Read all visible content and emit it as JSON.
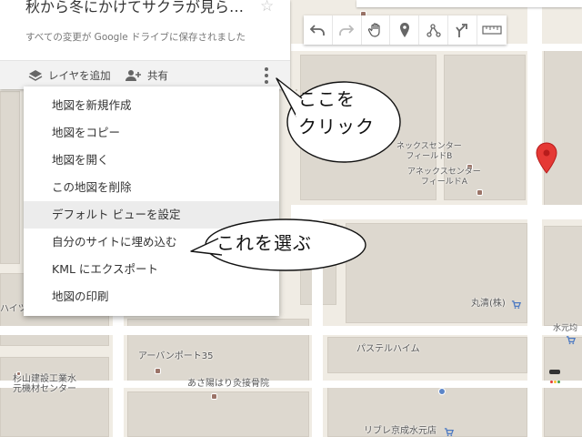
{
  "panel": {
    "title": "秋から冬にかけてサクラが見られ…",
    "star_icon": "star-outline-icon",
    "save_status": "すべての変更が Google ドライブに保存されました",
    "add_layer_label": "レイヤを追加",
    "share_label": "共有"
  },
  "menu": {
    "items": [
      {
        "label": "地図を新規作成"
      },
      {
        "label": "地図をコピー"
      },
      {
        "label": "地図を開く"
      },
      {
        "label": "この地図を削除"
      },
      {
        "label": "デフォルト ビューを設定"
      },
      {
        "label": "自分のサイトに埋め込む"
      },
      {
        "label": "KML にエクスポート"
      },
      {
        "label": "地図の印刷"
      }
    ],
    "highlighted_index": 4
  },
  "map_toolbar": {
    "buttons": [
      "undo-icon",
      "redo-icon",
      "hand-pan-icon",
      "add-marker-icon",
      "draw-line-icon",
      "directions-icon",
      "ruler-icon"
    ]
  },
  "map": {
    "labels": {
      "annex_center_b": "ネックスセンター\nフィールドB",
      "annex_center_a": "アネックスセンター\nフィールドA",
      "marukiyo": "丸清(株)",
      "urban_port": "アーバンポート35",
      "pastel_heim": "パステルハイム",
      "sugiyama": "杉山建設工業水\n元機材センター",
      "asahi_clinic": "あさ陽はり灸接骨院",
      "mizumoto": "水元均",
      "libre": "リブレ京成水元店",
      "heights": "ハイツ"
    }
  },
  "callouts": {
    "click_here": "ここを\nクリック",
    "choose_this": "これを選ぶ"
  },
  "colors": {
    "marker_red": "#e53935",
    "map_bg": "#f0ece4",
    "building": "#ddd8cf"
  }
}
